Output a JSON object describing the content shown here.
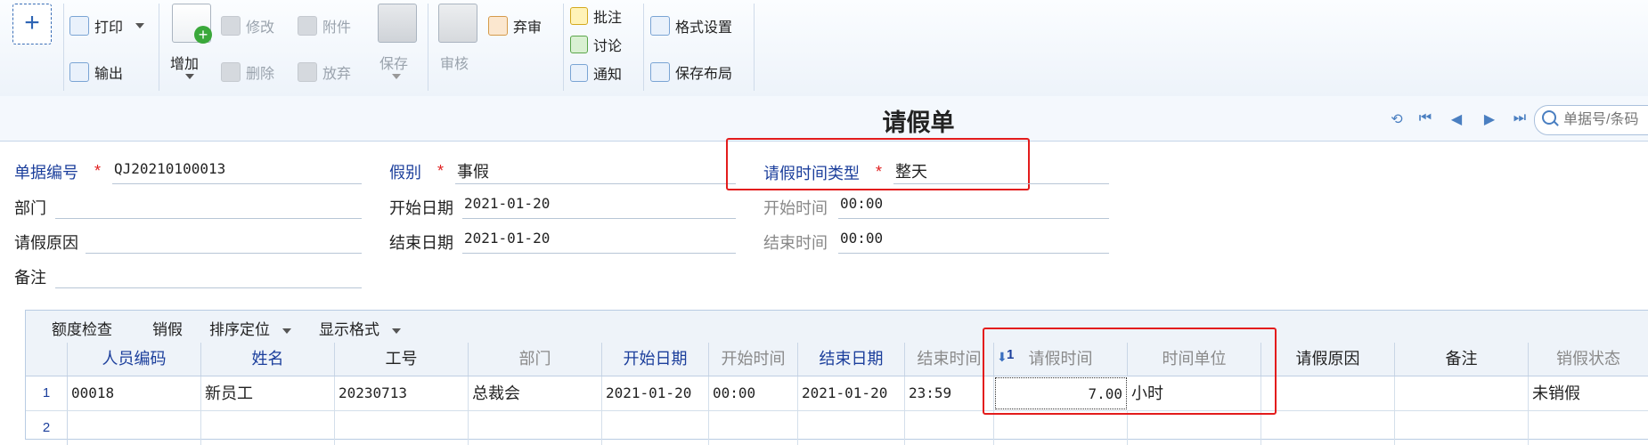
{
  "toolbar": {
    "print": "打印",
    "export": "输出",
    "add": "增加",
    "modify": "修改",
    "delete": "删除",
    "attach": "附件",
    "discard": "放弃",
    "save": "保存",
    "audit": "审核",
    "abandon_audit": "弃审",
    "annotate": "批注",
    "discuss": "讨论",
    "notify": "通知",
    "format_settings": "格式设置",
    "save_layout": "保存布局"
  },
  "title": "请假单",
  "search": {
    "placeholder": "单据号/条码"
  },
  "form": {
    "doc_no_label": "单据编号",
    "doc_no": "QJ20210100013",
    "leave_type_label": "假别",
    "leave_type": "事假",
    "time_type_label": "请假时间类型",
    "time_type": "整天",
    "dept_label": "部门",
    "dept": "",
    "start_date_label": "开始日期",
    "start_date": "2021-01-20",
    "start_time_label": "开始时间",
    "start_time": "00:00",
    "reason_label": "请假原因",
    "reason": "",
    "end_date_label": "结束日期",
    "end_date": "2021-01-20",
    "end_time_label": "结束时间",
    "end_time": "00:00",
    "remark_label": "备注",
    "remark": ""
  },
  "grid": {
    "toolbar": {
      "quota_check": "额度检查",
      "cancel_leave": "销假",
      "sort_locate": "排序定位",
      "display_format": "显示格式"
    },
    "columns": {
      "emp_code": "人员编码",
      "name": "姓名",
      "work_no": "工号",
      "dept": "部门",
      "start_date": "开始日期",
      "start_time": "开始时间",
      "end_date": "结束日期",
      "end_time": "结束时间",
      "sort_index": "1",
      "leave_hours": "请假时间",
      "time_unit": "时间单位",
      "reason": "请假原因",
      "remark": "备注",
      "cancel_status": "销假状态"
    },
    "rows": [
      {
        "num": "1",
        "emp_code": "00018",
        "name": "新员工",
        "work_no": "20230713",
        "dept": "总裁会",
        "start_date": "2021-01-20",
        "start_time": "00:00",
        "end_date": "2021-01-20",
        "end_time": "23:59",
        "leave_hours": "7.00",
        "time_unit": "小时",
        "reason": "",
        "remark": "",
        "cancel_status": "未销假"
      },
      {
        "num": "2"
      }
    ]
  }
}
